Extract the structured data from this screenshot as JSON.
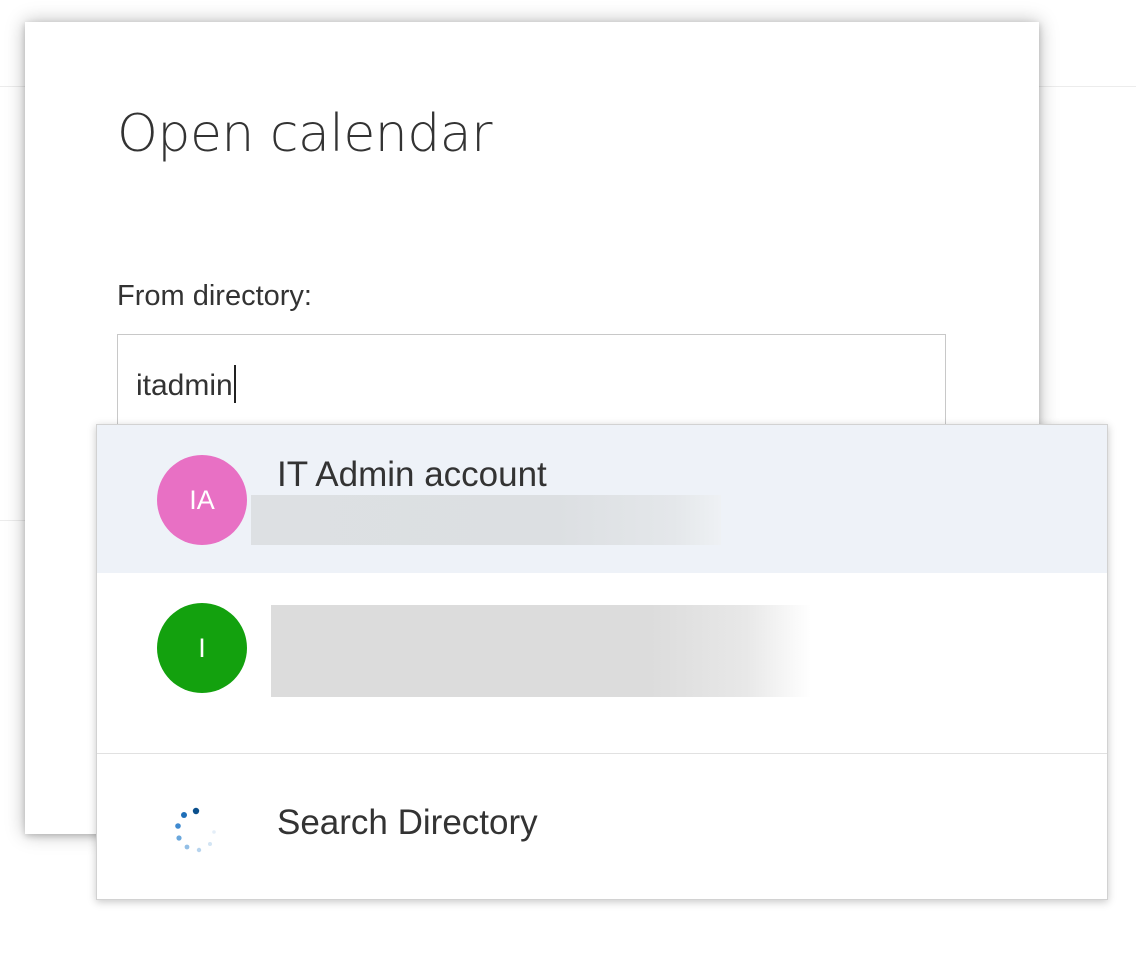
{
  "dialog": {
    "title": "Open calendar",
    "field_label": "From directory:",
    "input": {
      "value": "itadmin"
    }
  },
  "suggestions": [
    {
      "initials": "IA",
      "name": "IT Admin account",
      "avatar_color": "#e870c4",
      "secondary_redacted": true
    },
    {
      "initials": "I",
      "name": "",
      "avatar_color": "#13a10e",
      "name_redacted": true
    }
  ],
  "search_directory": {
    "label": "Search Directory",
    "icon": "loading-spinner-icon",
    "accent_color": "#0078d4"
  },
  "colors": {
    "highlight_row": "#eef2f8",
    "text": "#333333"
  }
}
